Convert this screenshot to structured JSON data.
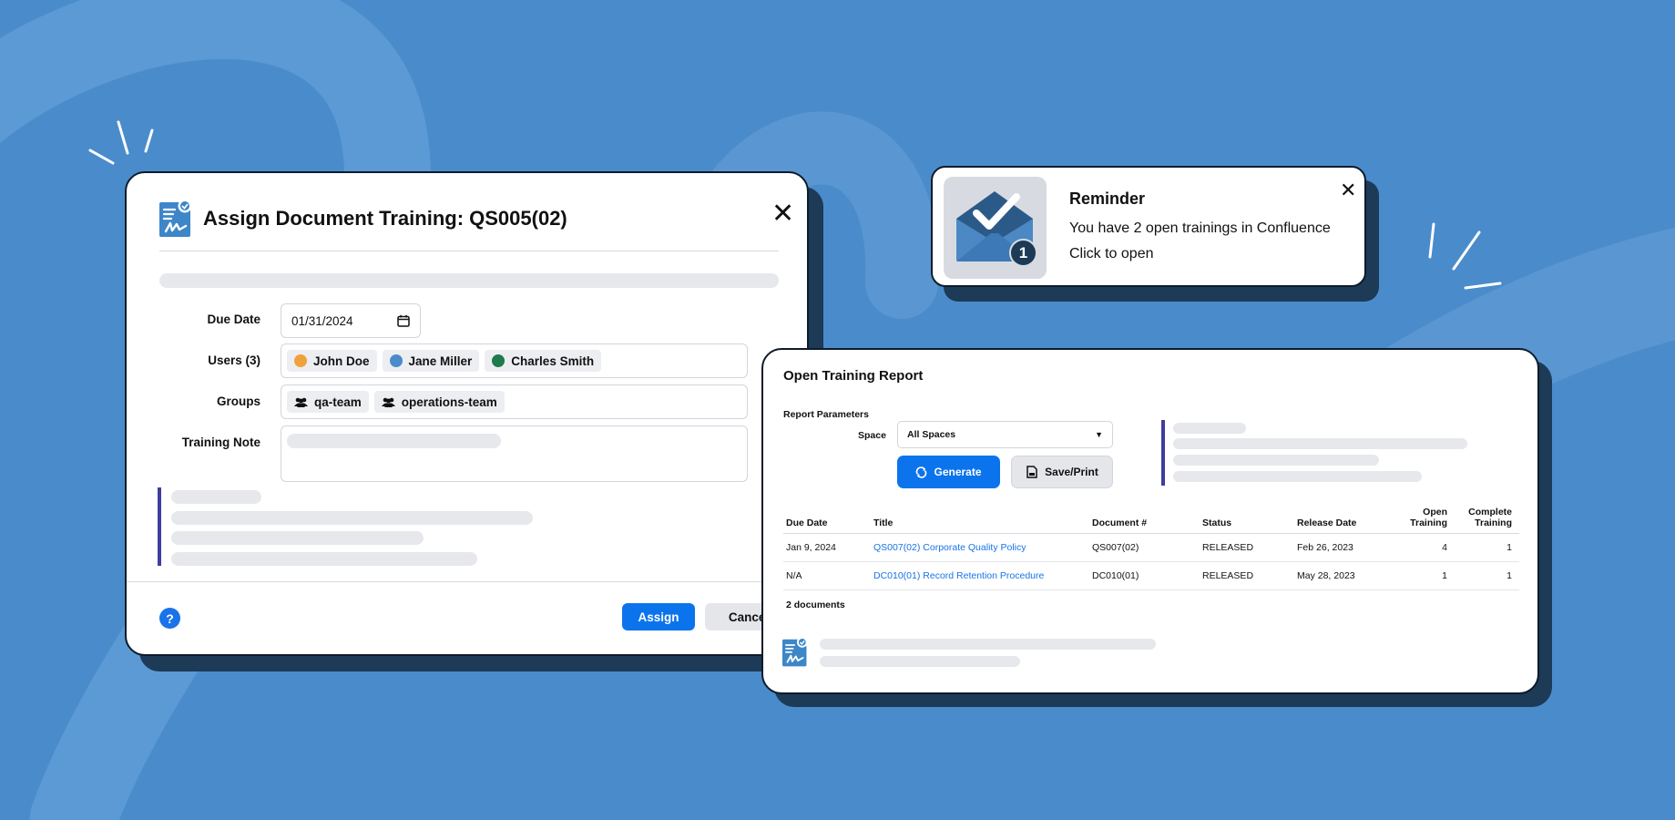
{
  "colors": {
    "background": "#4a8ccb",
    "panel_shadow": "#1d3a57",
    "primary": "#0b74ec",
    "link": "#1a73e8",
    "accent_bar": "#3f3d9e",
    "skeleton": "#e6e8ec"
  },
  "assign_dialog": {
    "icon": "document-training-icon",
    "title": "Assign Document Training: QS005(02)",
    "close_icon": "close-icon",
    "due_date": {
      "label": "Due Date",
      "value": "01/31/2024",
      "icon": "calendar-icon"
    },
    "users": {
      "label": "Users (3)",
      "items": [
        {
          "name": "John Doe",
          "color": "#f0a23a"
        },
        {
          "name": "Jane Miller",
          "color": "#4a8ccb"
        },
        {
          "name": "Charles Smith",
          "color": "#1e7a4a"
        }
      ]
    },
    "groups": {
      "label": "Groups",
      "icon": "group-icon",
      "items": [
        "qa-team",
        "operations-team"
      ]
    },
    "training_note": {
      "label": "Training Note"
    },
    "help_icon": "?",
    "assign_label": "Assign",
    "cancel_label": "Cancel"
  },
  "reminder": {
    "icon": "mail-check-icon",
    "badge": "1",
    "title": "Reminder",
    "message": "You have 2 open trainings in Confluence",
    "cta": "Click to open",
    "close_icon": "close-icon"
  },
  "report": {
    "title": "Open Training Report",
    "params_label": "Report Parameters",
    "space_label": "Space",
    "space_value": "All Spaces",
    "generate_label": "Generate",
    "save_label": "Save/Print",
    "columns": {
      "due_date": "Due Date",
      "title": "Title",
      "document": "Document #",
      "status": "Status",
      "release_date": "Release Date",
      "open_training": "Open Training",
      "complete_training": "Complete Training"
    },
    "rows": [
      {
        "due_date": "Jan 9, 2024",
        "title": "QS007(02) Corporate Quality Policy",
        "document": "QS007(02)",
        "status": "RELEASED",
        "release_date": "Feb 26, 2023",
        "open_training": "4",
        "complete_training": "1"
      },
      {
        "due_date": "N/A",
        "title": "DC010(01) Record Retention Procedure",
        "document": "DC010(01)",
        "status": "RELEASED",
        "release_date": "May 28, 2023",
        "open_training": "1",
        "complete_training": "1"
      }
    ],
    "count_label": "2 documents"
  }
}
